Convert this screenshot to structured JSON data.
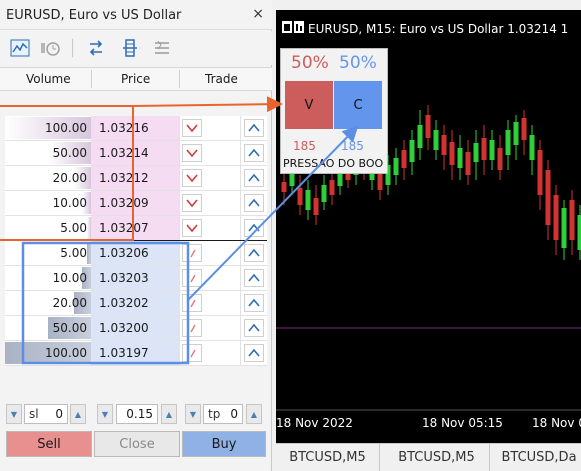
{
  "depth": {
    "title": "EURUSD, Euro vs US Dollar",
    "close": "×",
    "columns": {
      "volume": "Volume",
      "price": "Price",
      "trade": "Trade"
    },
    "rows": [
      {
        "side": "sell",
        "volume": "100.00",
        "price": "1.03216",
        "depth": 1.0
      },
      {
        "side": "sell",
        "volume": "50.00",
        "price": "1.03214",
        "depth": 0.5
      },
      {
        "side": "sell",
        "volume": "20.00",
        "price": "1.03212",
        "depth": 0.2
      },
      {
        "side": "sell",
        "volume": "10.00",
        "price": "1.03209",
        "depth": 0.1
      },
      {
        "side": "sell",
        "volume": "5.00",
        "price": "1.03207",
        "depth": 0.05
      },
      {
        "side": "buy",
        "volume": "5.00",
        "price": "1.03206",
        "depth": 0.05
      },
      {
        "side": "buy",
        "volume": "10.00",
        "price": "1.03203",
        "depth": 0.1
      },
      {
        "side": "buy",
        "volume": "20.00",
        "price": "1.03202",
        "depth": 0.2
      },
      {
        "side": "buy",
        "volume": "50.00",
        "price": "1.03200",
        "depth": 0.5
      },
      {
        "side": "buy",
        "volume": "100.00",
        "price": "1.03197",
        "depth": 1.0
      }
    ],
    "sl_label": "sl",
    "sl_value": "0",
    "volume_value": "0.15",
    "tp_label": "tp",
    "tp_value": "0",
    "sell_label": "Sell",
    "close_label": "Close",
    "buy_label": "Buy",
    "colors": {
      "ask": "#f5dcf2",
      "bid": "#dbe5f7",
      "sell_btn": "#e88f8f",
      "buy_btn": "#8fb1e6"
    }
  },
  "chart": {
    "title": "EURUSD, M15:  Euro vs US Dollar  1.03214 1",
    "widget": {
      "sell_pct": "50%",
      "buy_pct": "50%",
      "sell_box": "V",
      "buy_box": "C",
      "sell_count": "185",
      "buy_count": "185",
      "caption": "PRESSAO DO BOO"
    },
    "dates": [
      "18 Nov 2022",
      "18 Nov 05:15",
      "18 Nov 0"
    ],
    "colors": {
      "up": "#2fcf3a",
      "down": "#d23232",
      "background": "#000000",
      "level_line": "#7a2a7a",
      "sell": "#cd5c5c",
      "buy": "#6495ed"
    }
  },
  "tabs": [
    "BTCUSD,M5",
    "BTCUSD,M5",
    "BTCUSD,Da"
  ]
}
